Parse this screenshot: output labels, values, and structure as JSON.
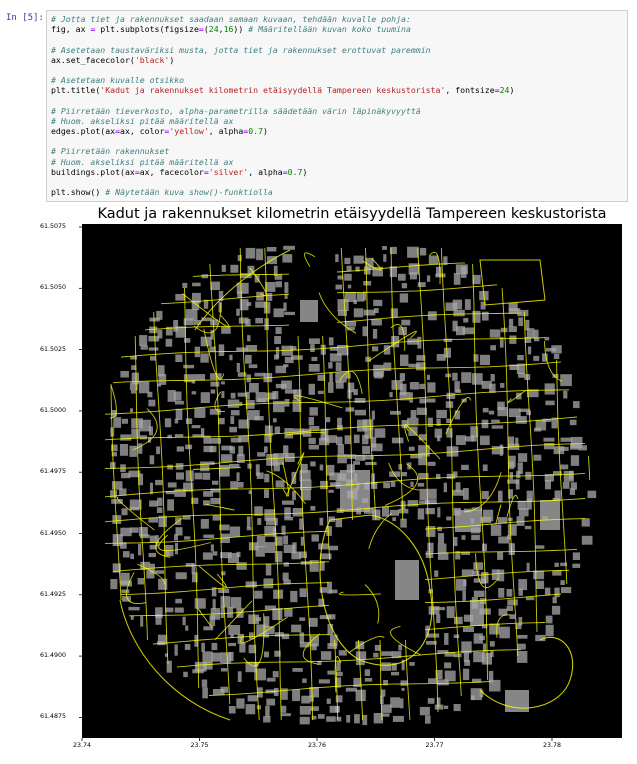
{
  "cell": {
    "prompt": "In [5]:",
    "lines": [
      [
        {
          "t": "# Jotta tiet ja rakennukset saadaan samaan kuvaan, tehdään kuvalle pohja:",
          "c": "cm"
        }
      ],
      [
        {
          "t": "fig, ax ",
          "c": ""
        },
        {
          "t": "=",
          "c": "op"
        },
        {
          "t": " plt.subplots(figsize",
          "c": ""
        },
        {
          "t": "=",
          "c": "op"
        },
        {
          "t": "(",
          "c": ""
        },
        {
          "t": "24",
          "c": "nm"
        },
        {
          "t": ",",
          "c": ""
        },
        {
          "t": "16",
          "c": "nm"
        },
        {
          "t": ")) ",
          "c": ""
        },
        {
          "t": "# Määritellään kuvan koko tuumina",
          "c": "cm"
        }
      ],
      [],
      [
        {
          "t": "# Asetetaan taustaväriksi musta, jotta tiet ja rakennukset erottuvat paremmin",
          "c": "cm"
        }
      ],
      [
        {
          "t": "ax.set_facecolor(",
          "c": ""
        },
        {
          "t": "'black'",
          "c": "st"
        },
        {
          "t": ")",
          "c": ""
        }
      ],
      [],
      [
        {
          "t": "# Asetetaan kuvalle otsikko",
          "c": "cm"
        }
      ],
      [
        {
          "t": "plt.title(",
          "c": ""
        },
        {
          "t": "'Kadut ja rakennukset kilometrin etäisyydellä Tampereen keskustorista'",
          "c": "st"
        },
        {
          "t": ", fontsize",
          "c": ""
        },
        {
          "t": "=",
          "c": "op"
        },
        {
          "t": "24",
          "c": "nm"
        },
        {
          "t": ")",
          "c": ""
        }
      ],
      [],
      [
        {
          "t": "# Piirretään tieverkosto, alpha-parametrilla säädetään värin läpinäkyvyyttä",
          "c": "cm"
        }
      ],
      [
        {
          "t": "# Huom. akseliksi pitää määritellä ax",
          "c": "cm"
        }
      ],
      [
        {
          "t": "edges.plot(ax",
          "c": ""
        },
        {
          "t": "=",
          "c": "op"
        },
        {
          "t": "ax, color",
          "c": ""
        },
        {
          "t": "=",
          "c": "op"
        },
        {
          "t": "'yellow'",
          "c": "st"
        },
        {
          "t": ", alpha",
          "c": ""
        },
        {
          "t": "=",
          "c": "op"
        },
        {
          "t": "0.7",
          "c": "nm"
        },
        {
          "t": ")",
          "c": ""
        }
      ],
      [],
      [
        {
          "t": "# Piirretään rakennukset",
          "c": "cm"
        }
      ],
      [
        {
          "t": "# Huom. akseliksi pitää määritellä ax",
          "c": "cm"
        }
      ],
      [
        {
          "t": "buildings.plot(ax",
          "c": ""
        },
        {
          "t": "=",
          "c": "op"
        },
        {
          "t": "ax, facecolor",
          "c": ""
        },
        {
          "t": "=",
          "c": "op"
        },
        {
          "t": "'silver'",
          "c": "st"
        },
        {
          "t": ", alpha",
          "c": ""
        },
        {
          "t": "=",
          "c": "op"
        },
        {
          "t": "0.7",
          "c": "nm"
        },
        {
          "t": ")",
          "c": ""
        }
      ],
      [],
      [
        {
          "t": "plt.show() ",
          "c": ""
        },
        {
          "t": "# Näytetään kuva show()-funktiolla",
          "c": "cm"
        }
      ]
    ]
  },
  "plot": {
    "title": "Kadut ja rakennukset kilometrin etäisyydellä Tampereen keskustorista",
    "background": "#000000",
    "street_color": "#ffff00",
    "building_color": "#a8a8a8",
    "y_ticks": [
      "61.5075",
      "61.5050",
      "61.5025",
      "61.5000",
      "61.4975",
      "61.4950",
      "61.4925",
      "61.4900",
      "61.4875"
    ],
    "x_ticks": [
      "23.74",
      "23.75",
      "23.76",
      "23.77",
      "23.78"
    ]
  }
}
